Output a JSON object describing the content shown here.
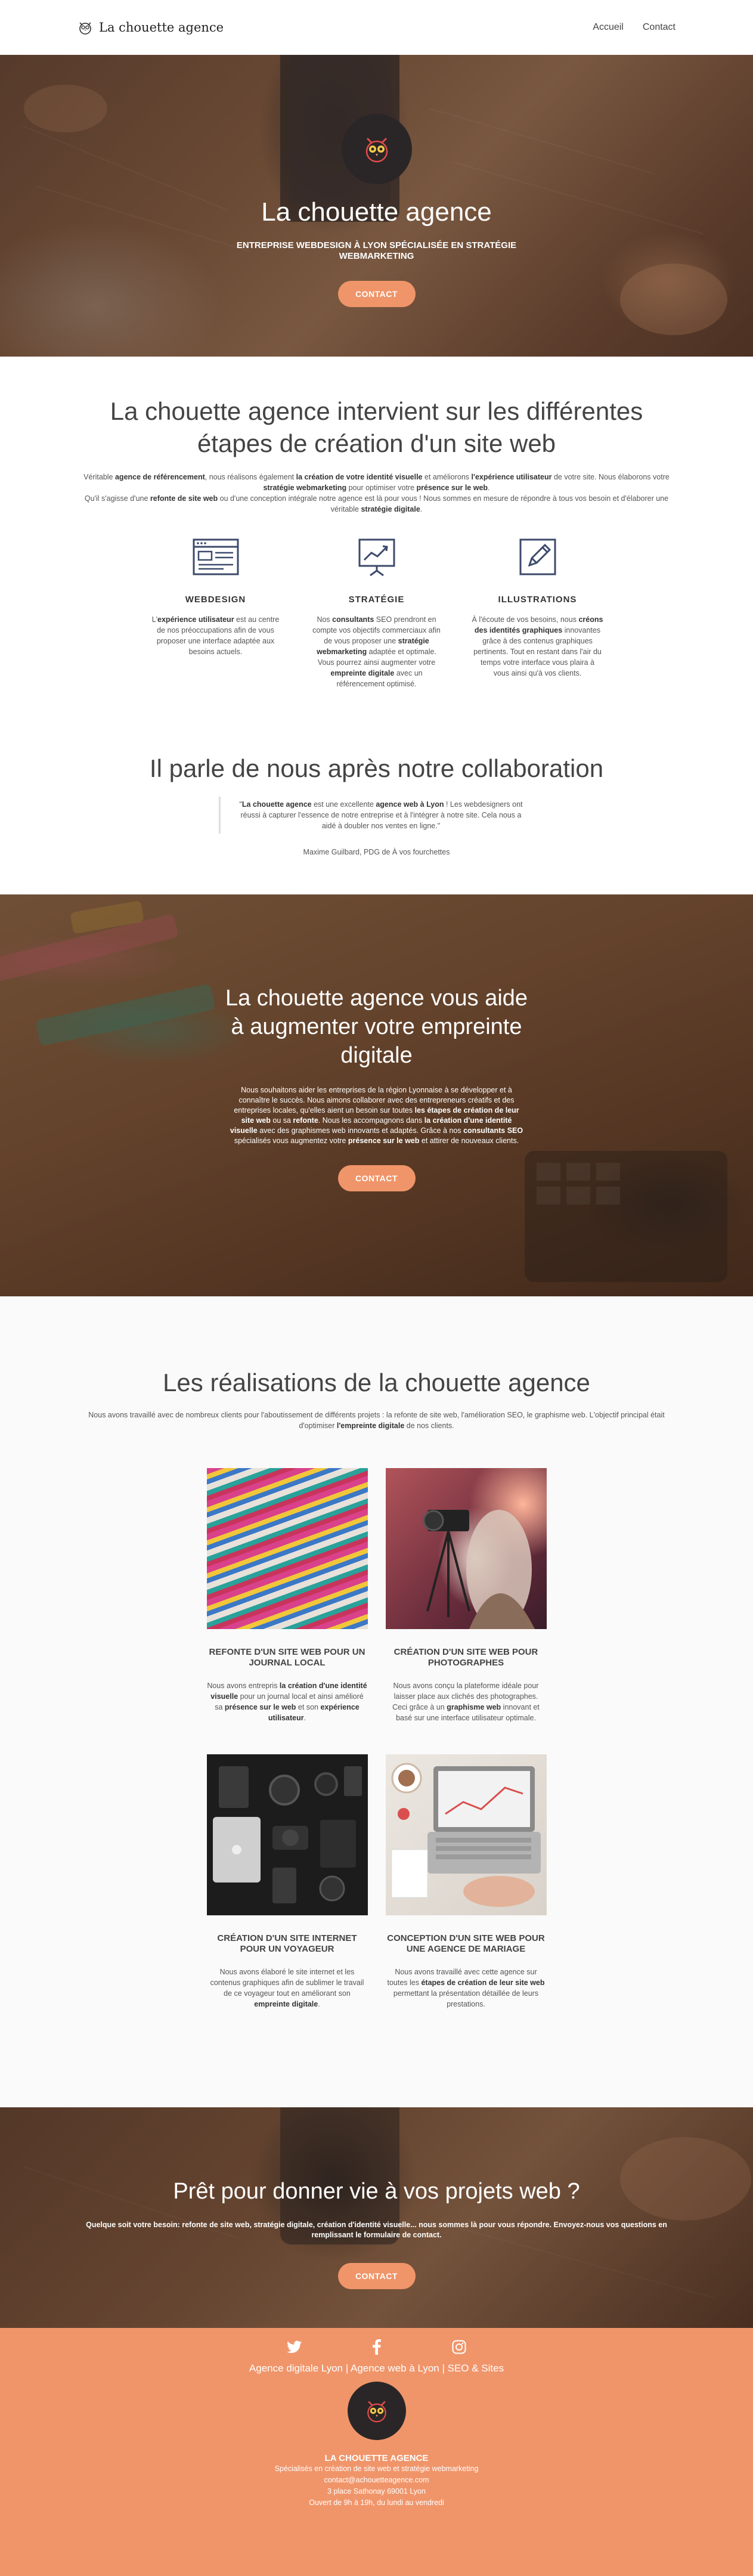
{
  "header": {
    "logo_text": "La chouette agence",
    "nav": [
      "Accueil",
      "Contact"
    ]
  },
  "hero": {
    "title": "La chouette agence",
    "subtitle": "ENTREPRISE WEBDESIGN À LYON SPÉCIALISÉE EN STRATÉGIE WEBMARKETING",
    "button": "CONTACT"
  },
  "intro": {
    "title": "La chouette agence intervient sur les différentes étapes de création d'un site web",
    "paragraph_1_parts": [
      "Véritable ",
      "agence de référencement",
      ", nous réalisons également ",
      "la création de votre identité visuelle",
      " et améliorons ",
      "l'expérience utilisateur",
      " de votre site. Nous élaborons votre ",
      "stratégie webmarketing",
      " pour optimiser votre ",
      "présence sur le web",
      "."
    ],
    "paragraph_2_parts": [
      "Qu'il s'agisse d'une ",
      "refonte de site web",
      " ou d'une conception intégrale notre agence est là pour vous ! Nous sommes en mesure de répondre à tous vos besoin et d'élaborer une véritable ",
      "stratégie digitale",
      "."
    ],
    "features": [
      {
        "icon": "webdesign-icon",
        "title": "WEBDESIGN",
        "parts": [
          "L'",
          "expérience utilisateur",
          " est au centre de nos préoccupations afin de vous proposer une interface adaptée aux besoins actuels."
        ]
      },
      {
        "icon": "strategy-icon",
        "title": "STRATÉGIE",
        "parts": [
          "Nos ",
          "consultants",
          " SEO prendront en compte vos objectifs commerciaux afin de vous proposer une ",
          "stratégie webmarketing",
          " adaptée et optimale. Vous pourrez ainsi augmenter votre ",
          "empreinte digitale",
          " avec un référencement optimisé."
        ]
      },
      {
        "icon": "illustration-icon",
        "title": "ILLUSTRATIONS",
        "parts": [
          "À l'écoute de vos besoins, nous ",
          "créons des identités graphiques",
          " innovantes grâce à des contenus graphiques pertinents. Tout en restant dans l'air du temps votre interface vous plaira à vous ainsi qu'à vos clients."
        ]
      }
    ]
  },
  "testimonial": {
    "title": "Il parle de nous après notre collaboration",
    "quote_parts": [
      "\"",
      "La chouette agence",
      " est une excellente ",
      "agence web à Lyon",
      " ! Les webdesigners ont réussi à capturer l'essence de notre entreprise et à l'intégrer à notre site. Cela nous a aidé à doubler nos ventes en ligne.\""
    ],
    "author": "Maxime Guilbard, PDG de À vos fourchettes"
  },
  "band": {
    "title": "La chouette agence vous aide à augmenter votre empreinte digitale",
    "text_parts": [
      "Nous souhaitons aider les entreprises de la région Lyonnaise à se développer et à connaître le succès. Nous aimons collaborer avec des entrepreneurs créatifs et des entreprises locales, qu'elles aient un besoin sur toutes ",
      "les étapes de création de leur site web",
      " ou sa ",
      "refonte",
      ". Nous les accompagnons dans ",
      "la création d'une identité visuelle",
      " avec des graphismes web innovants et adaptés. Grâce à nos ",
      "consultants SEO",
      " spécialisés vous augmentez votre ",
      "présence sur le web",
      " et attirer de nouveaux clients."
    ],
    "button": "CONTACT"
  },
  "works": {
    "title": "Les réalisations de la chouette agence",
    "text_parts": [
      "Nous avons travaillé avec de nombreux clients pour l'aboutissement de différents projets : la refonte de site web, l'amélioration SEO, le graphisme web. L'objectif principal était d'optimiser ",
      "l'empreinte digitale",
      " de nos clients."
    ],
    "items": [
      {
        "image": "magazines-image",
        "title": "REFONTE D'UN SITE WEB POUR UN JOURNAL LOCAL",
        "parts": [
          "Nous avons entrepris ",
          "la création d'une identité visuelle",
          " pour un journal local et ainsi amélioré sa ",
          "présence sur le web",
          " et son ",
          "expérience utilisateur",
          "."
        ]
      },
      {
        "image": "photographer-image",
        "title": "CRÉATION D'UN SITE WEB POUR PHOTOGRAPHES",
        "parts": [
          "Nous avons conçu la plateforme idéale pour laisser place aux clichés des photographes. Ceci grâce à un ",
          "graphisme web",
          " innovant et basé sur une interface utilisateur optimale."
        ]
      },
      {
        "image": "travel-gear-image",
        "title": "CRÉATION D'UN SITE INTERNET POUR UN VOYAGEUR",
        "parts": [
          "Nous avons élaboré le site internet et les contenus graphiques afin de sublimer le travail de ce voyageur tout en améliorant son ",
          "empreinte digitale",
          "."
        ]
      },
      {
        "image": "wedding-desk-image",
        "title": "CONCEPTION D'UN SITE WEB POUR UNE AGENCE DE MARIAGE",
        "parts": [
          "Nous avons travaillé avec cette agence sur toutes les ",
          "étapes de création de leur site web",
          " permettant la présentation détaillée de leurs prestations."
        ]
      }
    ]
  },
  "final_cta": {
    "title": "Prêt pour donner vie à vos projets web ?",
    "text": "Quelque soit votre besoin: refonte de site web, stratégie digitale, création d'identité visuelle... nous sommes là pour vous répondre. Envoyez-nous vos questions en remplissant le formulaire de contact.",
    "button": "CONTACT"
  },
  "footer": {
    "social_icons": [
      "twitter-icon",
      "facebook-icon",
      "instagram-icon"
    ],
    "links": "Agence digitale Lyon | Agence web à Lyon | SEO & Sites",
    "name": "LA CHOUETTE AGENCE",
    "lines": [
      "Spécialisés en création de site web et stratégie webmarketing",
      "contact@achouetteagence.com",
      "3 place Sathonay 69001 Lyon",
      "Ouvert de 9h à 19h, du lundi au vendredi"
    ]
  },
  "colors": {
    "accent": "#f0956a",
    "icon_stroke": "#3d4a6b",
    "owl_bg": "#2a2627",
    "owl_accent": "#e24b4b"
  }
}
